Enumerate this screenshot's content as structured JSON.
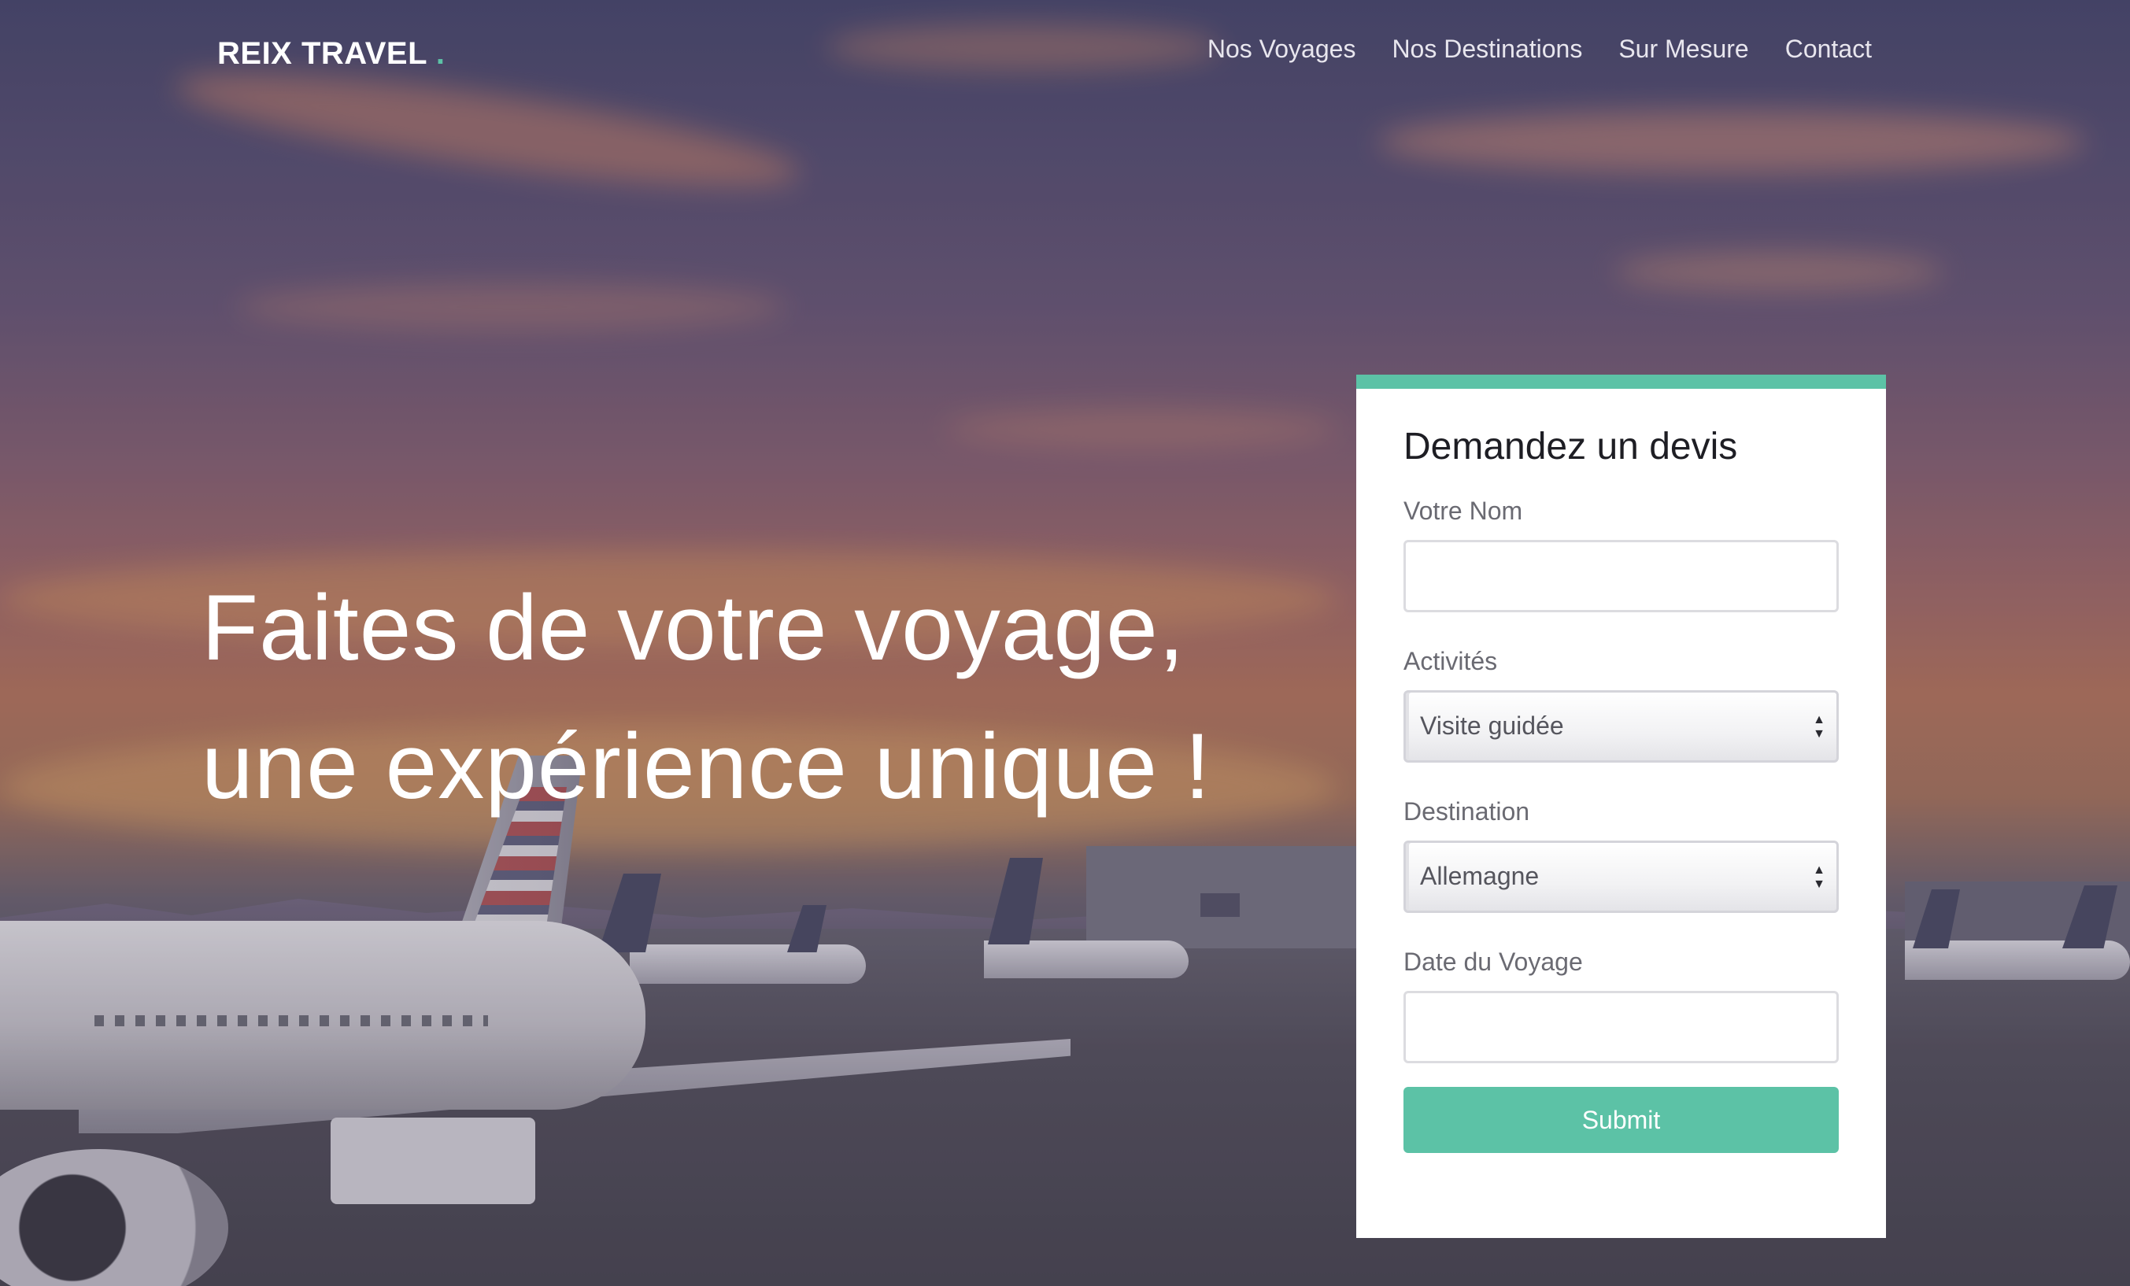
{
  "nav": {
    "brand": "REIX TRAVEL",
    "brand_dot": ".",
    "links": [
      {
        "label": "Nos Voyages"
      },
      {
        "label": "Nos Destinations"
      },
      {
        "label": "Sur Mesure"
      },
      {
        "label": "Contact"
      }
    ]
  },
  "hero": {
    "headline_line1": "Faites de votre voyage,",
    "headline_line2": "une expérience unique !"
  },
  "form": {
    "title": "Demandez un devis",
    "fields": {
      "name": {
        "label": "Votre Nom",
        "value": ""
      },
      "activities": {
        "label": "Activités",
        "selected": "Visite guidée"
      },
      "destination": {
        "label": "Destination",
        "selected": "Allemagne"
      },
      "date": {
        "label": "Date du Voyage",
        "value": ""
      }
    },
    "submit_label": "Submit"
  },
  "colors": {
    "accent": "#5cc2a6",
    "card_background": "#ffffff",
    "nav_text": "#e8e6ee"
  }
}
